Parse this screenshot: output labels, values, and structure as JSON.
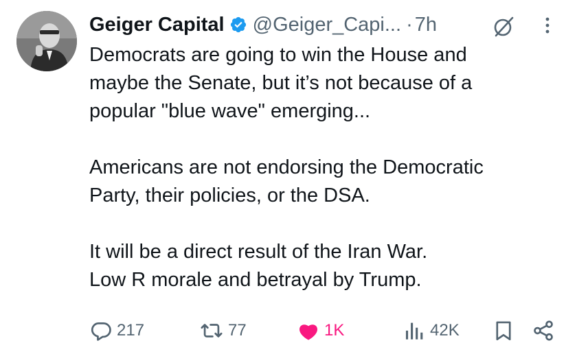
{
  "author": {
    "display_name": "Geiger Capital",
    "handle": "@Geiger_Capi...",
    "separator": "·",
    "time": "7h",
    "verified": true
  },
  "tweet": {
    "paragraphs": [
      [
        "Democrats are going to win the House and",
        "maybe the Senate, but it’s not because of a",
        "popular \"blue wave\" emerging..."
      ],
      [
        "Americans are not endorsing the Democratic",
        "Party, their policies, or the DSA."
      ],
      [
        "It will be a direct result of the Iran War.",
        "Low R morale and betrayal by Trump."
      ]
    ]
  },
  "metrics": {
    "replies": "217",
    "reposts": "77",
    "likes": "1K",
    "views": "42K"
  },
  "colors": {
    "text": "#0f1419",
    "secondary": "#536471",
    "verified": "#1d9bf0",
    "like": "#f91880"
  },
  "icons": {
    "verified": "verified-badge-icon",
    "grok": "grok-icon",
    "more": "more-icon",
    "reply": "reply-icon",
    "repost": "repost-icon",
    "like": "heart-icon",
    "views": "views-icon",
    "bookmark": "bookmark-icon",
    "share": "share-icon"
  }
}
